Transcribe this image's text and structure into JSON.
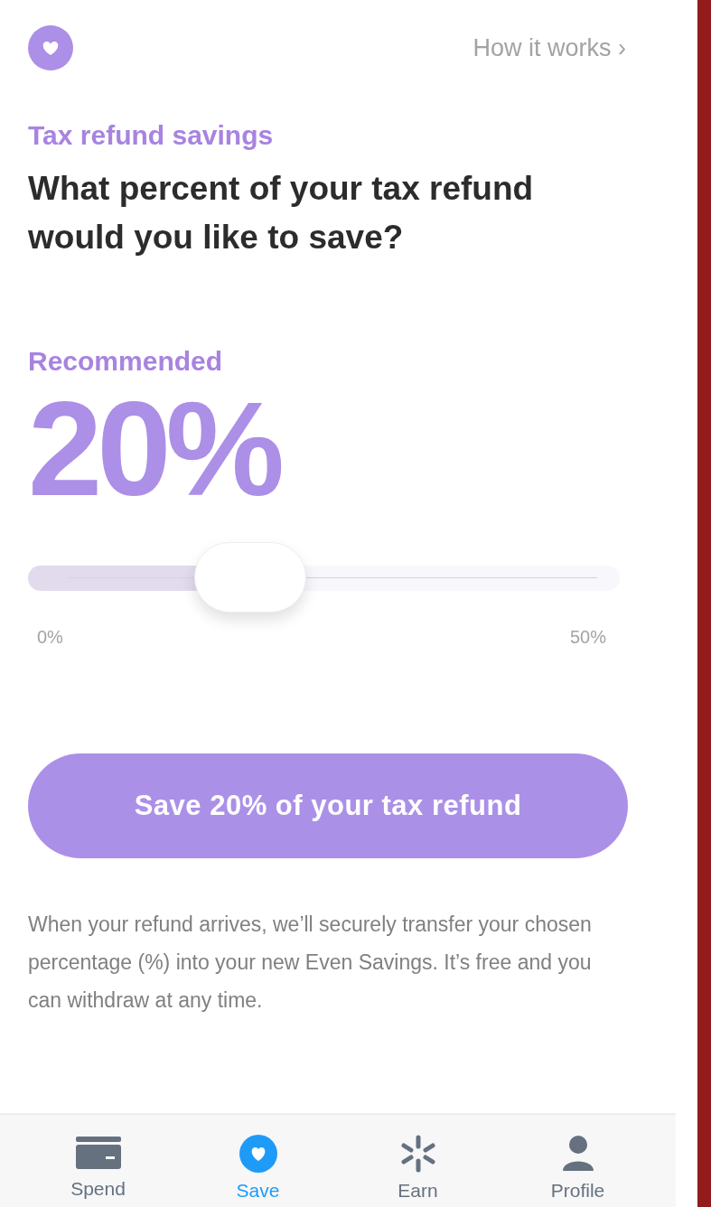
{
  "header": {
    "link": "How it works ›"
  },
  "eyebrow": "Tax refund savings",
  "title": "What percent of your tax refund would you like to save?",
  "recommended": {
    "label": "Recommended",
    "value": "20%"
  },
  "slider": {
    "level": 0.375,
    "min_label": "0%",
    "max_label": "50%"
  },
  "button": "Save 20% of your tax refund",
  "note": "When your refund arrives, we’ll securely transfer your chosen percentage (%) into your new Even Savings. It’s free and you can withdraw at any time.",
  "tabs": [
    {
      "kind": "card",
      "label": "Spend",
      "selected": false
    },
    {
      "kind": "heart",
      "label": "Save",
      "selected": true
    },
    {
      "kind": "spark",
      "label": "Earn",
      "selected": false
    },
    {
      "kind": "person",
      "label": "Profile",
      "selected": false
    }
  ]
}
